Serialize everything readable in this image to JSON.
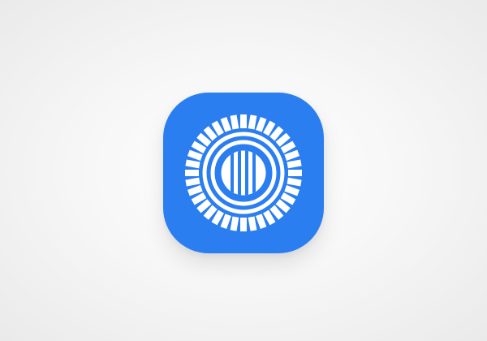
{
  "app_icon": {
    "icon": "prezi-logo-icon",
    "background_color": "#2a7ef0",
    "glyph_color": "#ffffff"
  }
}
